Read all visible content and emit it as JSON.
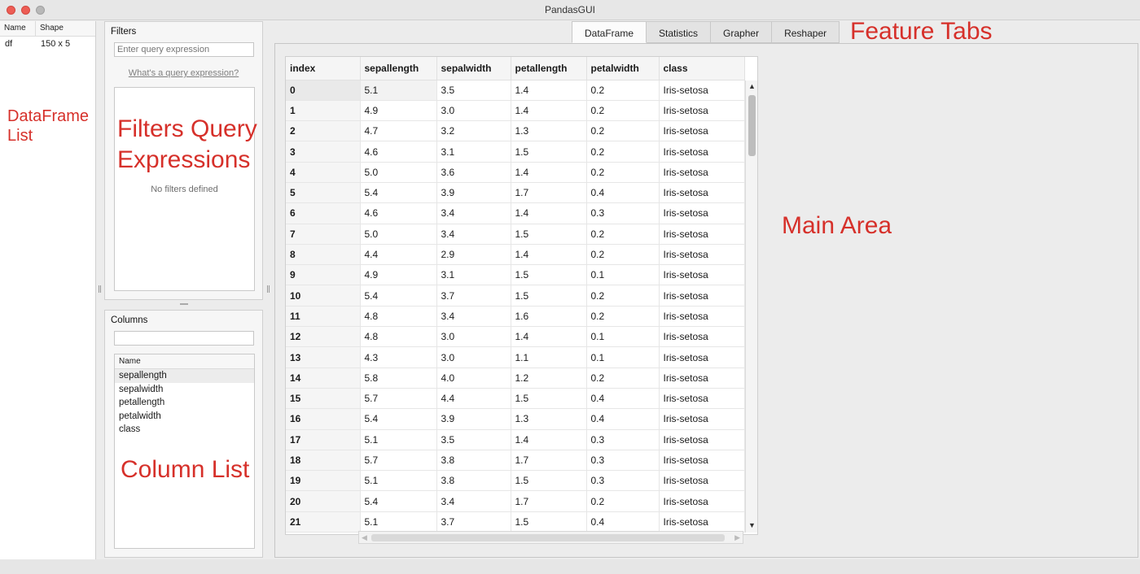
{
  "window": {
    "title": "PandasGUI"
  },
  "dataframe_list": {
    "headers": [
      "Name",
      "Shape"
    ],
    "rows": [
      {
        "name": "df",
        "shape": "150 x 5"
      }
    ]
  },
  "filters": {
    "title": "Filters",
    "placeholder": "Enter query expression",
    "help_link": "What's a query expression?",
    "empty_text": "No filters defined"
  },
  "columns_panel": {
    "title": "Columns",
    "search_value": "",
    "list_header": "Name",
    "items": [
      "sepallength",
      "sepalwidth",
      "petallength",
      "petalwidth",
      "class"
    ]
  },
  "tabs": [
    "DataFrame",
    "Statistics",
    "Grapher",
    "Reshaper"
  ],
  "active_tab": "DataFrame",
  "table": {
    "columns": [
      "index",
      "sepallength",
      "sepalwidth",
      "petallength",
      "petalwidth",
      "class"
    ],
    "rows": [
      [
        "0",
        "5.1",
        "3.5",
        "1.4",
        "0.2",
        "Iris-setosa"
      ],
      [
        "1",
        "4.9",
        "3.0",
        "1.4",
        "0.2",
        "Iris-setosa"
      ],
      [
        "2",
        "4.7",
        "3.2",
        "1.3",
        "0.2",
        "Iris-setosa"
      ],
      [
        "3",
        "4.6",
        "3.1",
        "1.5",
        "0.2",
        "Iris-setosa"
      ],
      [
        "4",
        "5.0",
        "3.6",
        "1.4",
        "0.2",
        "Iris-setosa"
      ],
      [
        "5",
        "5.4",
        "3.9",
        "1.7",
        "0.4",
        "Iris-setosa"
      ],
      [
        "6",
        "4.6",
        "3.4",
        "1.4",
        "0.3",
        "Iris-setosa"
      ],
      [
        "7",
        "5.0",
        "3.4",
        "1.5",
        "0.2",
        "Iris-setosa"
      ],
      [
        "8",
        "4.4",
        "2.9",
        "1.4",
        "0.2",
        "Iris-setosa"
      ],
      [
        "9",
        "4.9",
        "3.1",
        "1.5",
        "0.1",
        "Iris-setosa"
      ],
      [
        "10",
        "5.4",
        "3.7",
        "1.5",
        "0.2",
        "Iris-setosa"
      ],
      [
        "11",
        "4.8",
        "3.4",
        "1.6",
        "0.2",
        "Iris-setosa"
      ],
      [
        "12",
        "4.8",
        "3.0",
        "1.4",
        "0.1",
        "Iris-setosa"
      ],
      [
        "13",
        "4.3",
        "3.0",
        "1.1",
        "0.1",
        "Iris-setosa"
      ],
      [
        "14",
        "5.8",
        "4.0",
        "1.2",
        "0.2",
        "Iris-setosa"
      ],
      [
        "15",
        "5.7",
        "4.4",
        "1.5",
        "0.4",
        "Iris-setosa"
      ],
      [
        "16",
        "5.4",
        "3.9",
        "1.3",
        "0.4",
        "Iris-setosa"
      ],
      [
        "17",
        "5.1",
        "3.5",
        "1.4",
        "0.3",
        "Iris-setosa"
      ],
      [
        "18",
        "5.7",
        "3.8",
        "1.7",
        "0.3",
        "Iris-setosa"
      ],
      [
        "19",
        "5.1",
        "3.8",
        "1.5",
        "0.3",
        "Iris-setosa"
      ],
      [
        "20",
        "5.4",
        "3.4",
        "1.7",
        "0.2",
        "Iris-setosa"
      ],
      [
        "21",
        "5.1",
        "3.7",
        "1.5",
        "0.4",
        "Iris-setosa"
      ]
    ]
  },
  "annotations": {
    "dataframe_list": [
      "DataFrame",
      "List"
    ],
    "filters": [
      "Filters Query",
      "Expressions"
    ],
    "column_list": "Column List",
    "feature_tabs": "Feature Tabs",
    "main_area": "Main Area"
  },
  "icons": {
    "scroll_up": "triangle-up",
    "scroll_down": "triangle-down",
    "scroll_left": "triangle-left",
    "scroll_right": "triangle-right"
  },
  "colors": {
    "annotation": "#d6302a",
    "close": "#ed5d55"
  }
}
